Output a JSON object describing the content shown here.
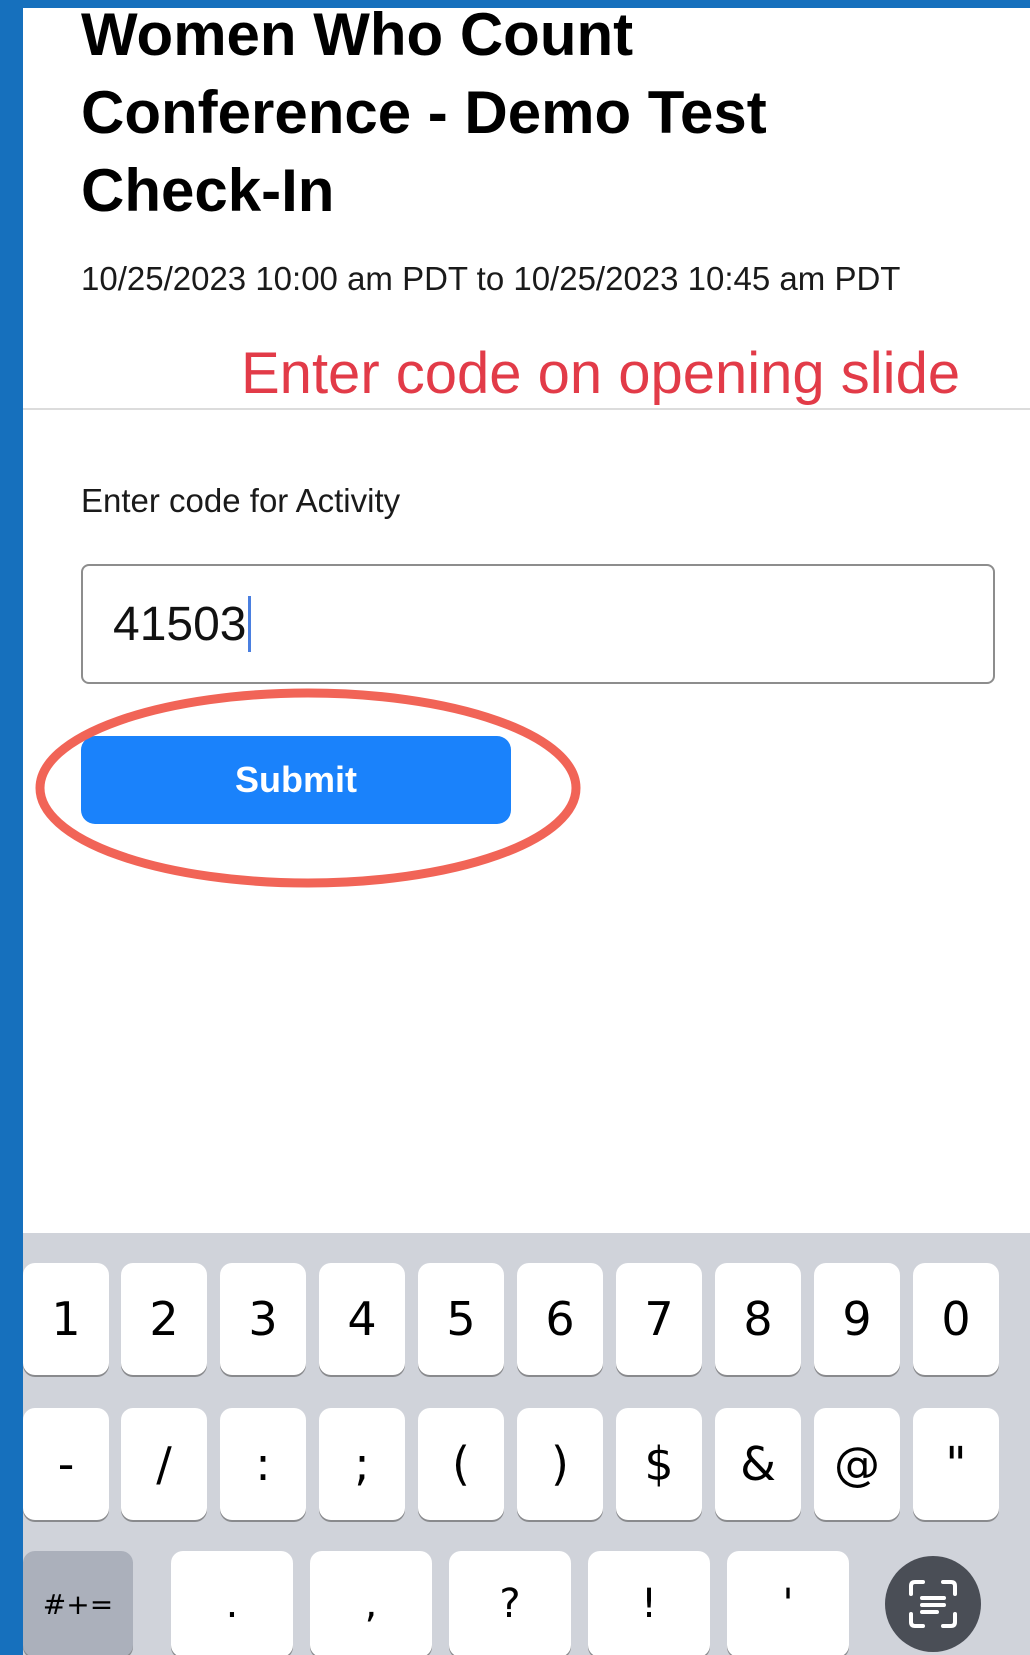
{
  "event": {
    "title_lines": [
      "Women Who Count",
      "Conference - Demo Test",
      "Check-In"
    ],
    "datetime": "10/25/2023 10:00 am PDT to 10/25/2023 10:45 am PDT"
  },
  "annotation": {
    "text": "Enter code on opening slide",
    "color": "#e23b48",
    "highlight_color": "#f16457"
  },
  "form": {
    "label": "Enter code for Activity",
    "code_value": "41503",
    "submit_label": "Submit"
  },
  "colors": {
    "page_border": "#1670bd",
    "submit_button": "#1a82fb",
    "keyboard_bg": "#d0d3da"
  },
  "keyboard": {
    "row1": [
      "1",
      "2",
      "3",
      "4",
      "5",
      "6",
      "7",
      "8",
      "9",
      "0"
    ],
    "row2": [
      "-",
      "/",
      ":",
      ";",
      "(",
      ")",
      "$",
      "&",
      "@",
      "\""
    ],
    "row3": {
      "mode_key": "#+=",
      "keys": [
        ".",
        ",",
        "?",
        "!",
        "'"
      ],
      "scan_icon": "scan-text-icon"
    }
  }
}
